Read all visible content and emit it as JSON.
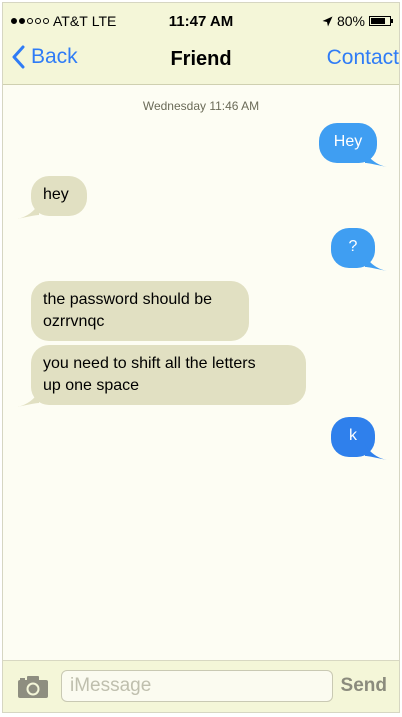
{
  "status_bar": {
    "carrier": "AT&T",
    "network": "LTE",
    "time": "11:47 AM",
    "battery": "80%",
    "battery_level": 0.8,
    "signal_bars_filled": 2,
    "signal_bars_total": 5
  },
  "nav": {
    "back_label": "Back",
    "title": "Friend",
    "contact_label": "Contact"
  },
  "conversation": {
    "timestamp": "Wednesday 11:46 AM",
    "messages": [
      {
        "direction": "outgoing",
        "lines": [
          "Hey"
        ]
      },
      {
        "direction": "incoming",
        "lines": [
          "hey"
        ]
      },
      {
        "direction": "outgoing",
        "lines": [
          "?"
        ]
      },
      {
        "direction": "incoming",
        "lines": [
          "the password should be",
          "ozrrvnqc"
        ]
      },
      {
        "direction": "incoming",
        "lines": [
          "you need to shift all the letters",
          "up one space"
        ]
      },
      {
        "direction": "outgoing",
        "lines": [
          "k"
        ]
      }
    ]
  },
  "composer": {
    "placeholder": "iMessage",
    "value": "",
    "send_label": "Send"
  },
  "colors": {
    "accent": "#2f7cf6",
    "outgoing_bubble": "#3f9ef2",
    "incoming_bubble": "#e1e0c2",
    "bar_background": "#f4f6d8"
  },
  "icons": {
    "back": "chevron-left-icon",
    "camera": "camera-icon",
    "location": "location-arrow-icon",
    "battery": "battery-icon"
  }
}
